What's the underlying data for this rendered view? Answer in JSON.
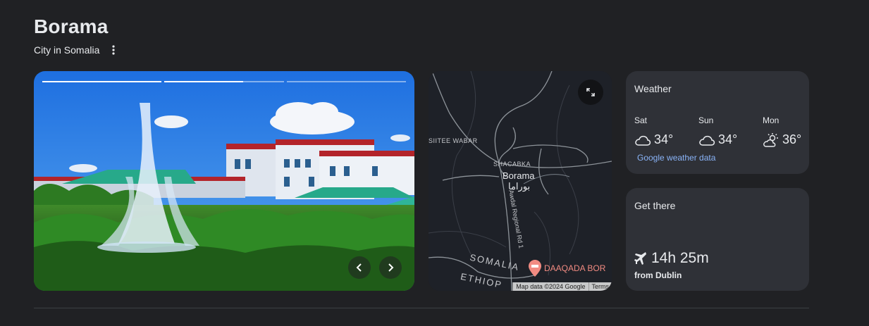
{
  "header": {
    "title": "Borama",
    "subtitle": "City in Somalia",
    "more_icon": "more-vert-icon"
  },
  "photo": {
    "progress": [
      1.0,
      0.66,
      0.0
    ],
    "prev_icon": "chevron-left-icon",
    "next_icon": "chevron-right-icon"
  },
  "map": {
    "labels": {
      "siitee": "SIITEE WABAR",
      "shacabka": "SHACABKA",
      "city": "Borama",
      "city_local": "بوراما",
      "road": "Awdal Regional Rd 1",
      "somalia": "SOMALIA",
      "ethiopia": "ETHIOP",
      "poi": "DAAQADA BOR"
    },
    "attribution": "Map data ©2024 Google",
    "terms": "Terms",
    "expand_icon": "expand-icon",
    "poi_icon": "lodging-pin-icon",
    "poi_color": "#f28b82"
  },
  "weather": {
    "title": "Weather",
    "days": [
      {
        "name": "Sat",
        "temp": "34°",
        "icon": "cloud-icon"
      },
      {
        "name": "Sun",
        "temp": "34°",
        "icon": "cloud-icon"
      },
      {
        "name": "Mon",
        "temp": "36°",
        "icon": "partly-cloudy-icon"
      }
    ],
    "source_link": "Google weather data",
    "link_color": "#8ab4f8"
  },
  "get_there": {
    "title": "Get there",
    "duration": "14h 25m",
    "from": "from Dublin",
    "icon": "airplane-icon"
  }
}
